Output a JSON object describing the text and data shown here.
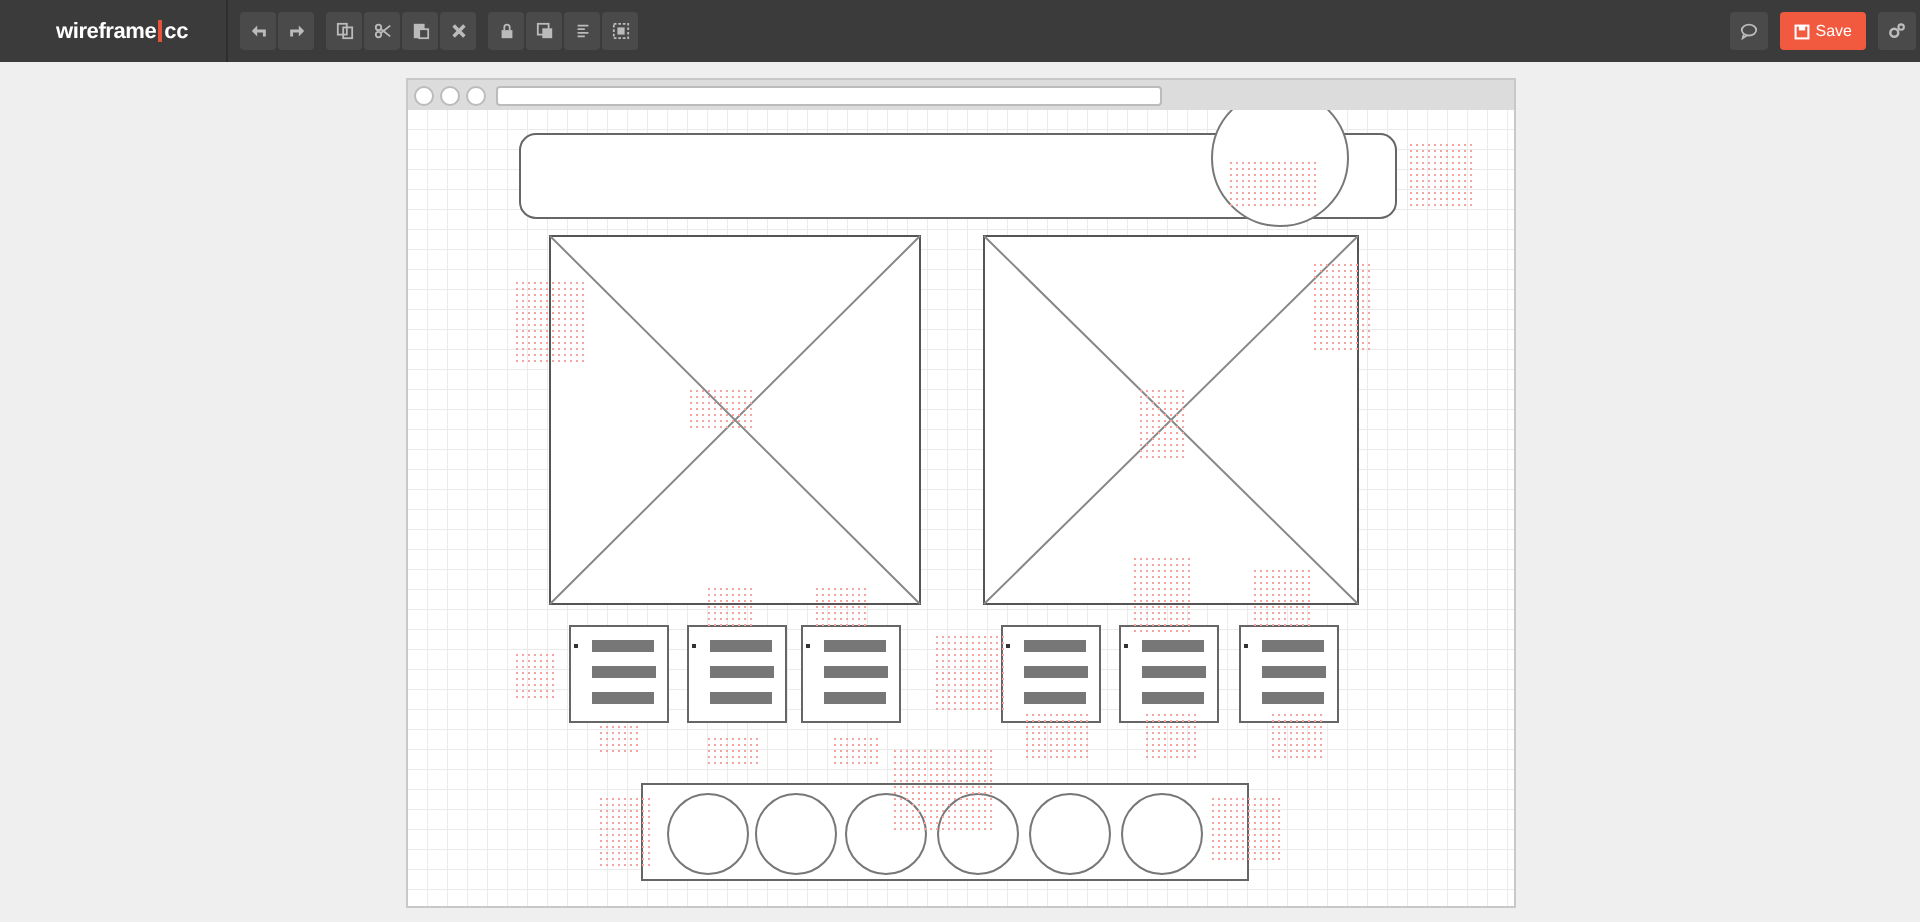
{
  "topbar": {
    "logo": {
      "name": "wireframe",
      "suffix": "cc"
    },
    "tool_groups": [
      {
        "buttons": [
          {
            "kind": "undo"
          },
          {
            "kind": "redo"
          }
        ]
      },
      {
        "buttons": [
          {
            "kind": "copy"
          },
          {
            "kind": "cut"
          },
          {
            "kind": "paste"
          },
          {
            "kind": "delete"
          }
        ]
      },
      {
        "buttons": [
          {
            "kind": "lock"
          },
          {
            "kind": "arrange"
          },
          {
            "kind": "align"
          },
          {
            "kind": "group"
          }
        ]
      }
    ],
    "right_buttons": [
      {
        "kind": "comment"
      },
      {
        "kind": "save",
        "label": "Save"
      },
      {
        "kind": "settings"
      }
    ]
  }
}
